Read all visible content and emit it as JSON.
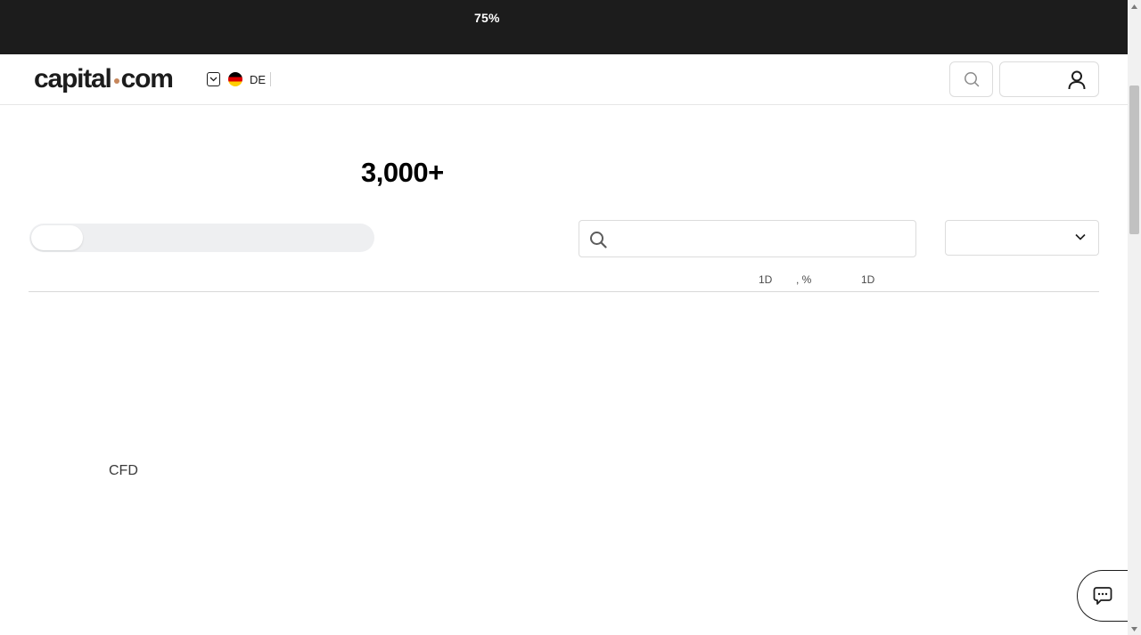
{
  "risk_banner": {
    "percent": "75%"
  },
  "header": {
    "logo_left": "capital",
    "logo_right": "com",
    "language_code": "DE"
  },
  "main": {
    "markets_count": "3,000+",
    "search": {
      "value": "",
      "placeholder": ""
    },
    "category_select_value": "",
    "table_headers": {
      "change_1d": "1D",
      "change_pct": ", %",
      "chart_1d": "1D"
    },
    "cfd_label": "CFD"
  },
  "colors": {
    "banner_bg": "#1c1c1c",
    "logo_dot": "#c6865b",
    "toggle_track": "#eeeff1",
    "border": "#dcdcdc"
  },
  "icons": {
    "lang_chevron": "chevron-down-icon",
    "flag": "germany-flag-icon",
    "header_search": "search-icon",
    "account": "user-icon",
    "market_search": "search-icon",
    "select_chevron": "chevron-down-icon",
    "chat": "chat-bubble-icon"
  }
}
